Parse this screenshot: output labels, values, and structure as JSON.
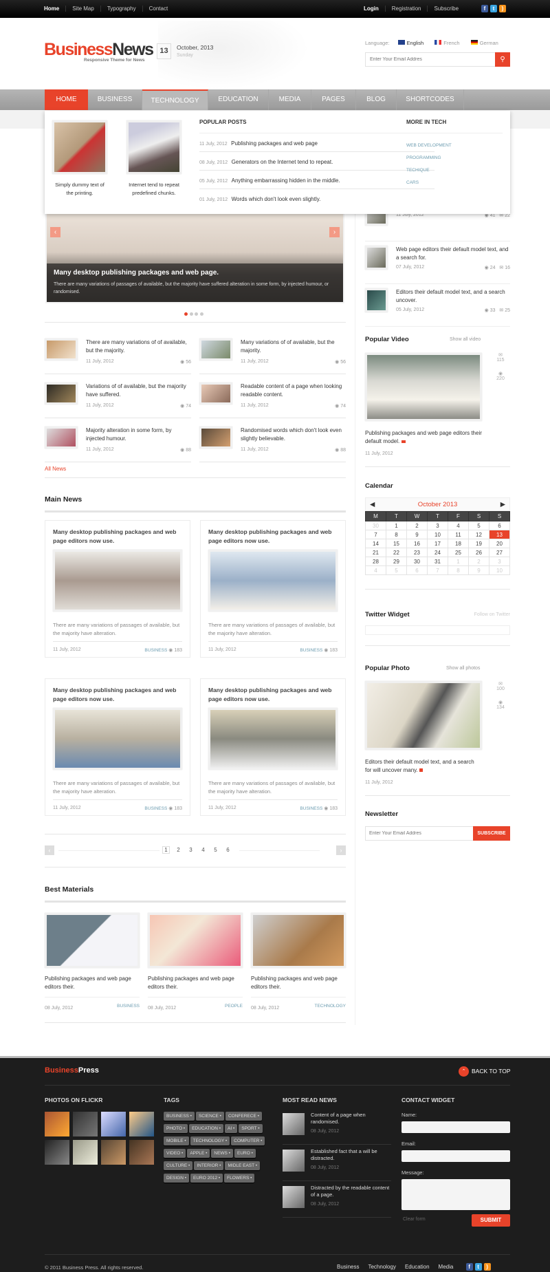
{
  "topbar": {
    "left": [
      "Home",
      "Site Map",
      "Typography",
      "Contact"
    ],
    "right": [
      "Login",
      "Registration",
      "Subscribe"
    ],
    "social": [
      "facebook-icon",
      "twitter-icon",
      "rss-icon"
    ]
  },
  "header": {
    "logo_a": "Business",
    "logo_b": "News",
    "tagline": "Responsive Theme for News",
    "day": "13",
    "month_year": "October, 2013",
    "weekday": "Sunday",
    "language_label": "Language:",
    "languages": [
      "English",
      "French",
      "German"
    ],
    "search_placeholder": "Enter Your Email Addres"
  },
  "nav": [
    "HOME",
    "BUSINESS",
    "TECHNOLOGY",
    "EDUCATION",
    "MEDIA",
    "PAGES",
    "BLOG",
    "SHORTCODES"
  ],
  "mega": {
    "features": [
      "Simply dummy text of the printing.",
      "Internet tend to repeat predefined chunks."
    ],
    "popular_title": "POPULAR POSTS",
    "popular": [
      {
        "date": "11 July, 2012",
        "title": "Publishing packages and web page"
      },
      {
        "date": "08 July, 2012",
        "title": "Generators on the Internet tend to repeat."
      },
      {
        "date": "05 July, 2012",
        "title": "Anything embarrassing hidden in the middle."
      },
      {
        "date": "01 July, 2012",
        "title": "Words which don't look even slightly."
      }
    ],
    "more_title": "MORE IN TECH",
    "more": [
      "WEB DEVELOPMENT",
      "PROGRAMMING",
      "TECHIQUE",
      "CARS"
    ]
  },
  "slider": {
    "title": "Many desktop publishing packages and web page.",
    "text": "There are many variations of passages of available, but the majority have suffered alteration in some form, by injected humour, or randomised.",
    "active_slide": 1,
    "slides": 4
  },
  "small_news": [
    {
      "title": "There are many variations of of available, but the majority.",
      "date": "11 July, 2012",
      "views": "56"
    },
    {
      "title": "Many variations of of available, but the majority.",
      "date": "11 July, 2012",
      "views": "56"
    },
    {
      "title": "Variations of of available, but the majority have suffered.",
      "date": "11 July, 2012",
      "views": "74"
    },
    {
      "title": "Readable content of a page when looking readable content.",
      "date": "11 July, 2012",
      "views": "74"
    },
    {
      "title": "Majority alteration in some form, by injected humour.",
      "date": "11 July, 2012",
      "views": "88"
    },
    {
      "title": "Randomised words which don't look even slightly believable.",
      "date": "11 July, 2012",
      "views": "88"
    }
  ],
  "all_news": "All News",
  "main_news": {
    "title": "Main News",
    "cards": [
      {
        "title": "Many desktop publishing packages and web page editors now use.",
        "text": "There are many variations of passages of available, but the majority have alteration.",
        "date": "11 July, 2012",
        "category": "BUSINESS",
        "views": "183"
      },
      {
        "title": "Many desktop publishing packages and web page editors now use.",
        "text": "There are many variations of passages of available, but the majority have alteration.",
        "date": "11 July, 2012",
        "category": "BUSINESS",
        "views": "183"
      },
      {
        "title": "Many desktop publishing packages and web page editors now use.",
        "text": "There are many variations of passages of available, but the majority have alteration.",
        "date": "11 July, 2012",
        "category": "BUSINESS",
        "views": "183"
      },
      {
        "title": "Many desktop publishing packages and web page editors now use.",
        "text": "There are many variations of passages of available, but the majority have alteration.",
        "date": "11 July, 2012",
        "category": "BUSINESS",
        "views": "183"
      }
    ],
    "pages": [
      "1",
      "2",
      "3",
      "4",
      "5",
      "6"
    ],
    "current_page": "1"
  },
  "best": {
    "title": "Best Materials",
    "items": [
      {
        "title": "Publishing packages and web page editors their.",
        "date": "08 July, 2012",
        "category": "BUSINESS"
      },
      {
        "title": "Publishing packages and web page editors their.",
        "date": "08 July, 2012",
        "category": "PEOPLE"
      },
      {
        "title": "Publishing packages and web page editors their.",
        "date": "08 July, 2012",
        "category": "TECHNOLOGY"
      }
    ]
  },
  "sidebar": {
    "list": [
      {
        "title": "",
        "date": "11 July, 2012",
        "views": "41",
        "comments": "22"
      },
      {
        "title": "Web page editors their default model text, and a search for.",
        "date": "07 July, 2012",
        "views": "24",
        "comments": "16"
      },
      {
        "title": "Editors their default model text, and a search uncover.",
        "date": "05 July, 2012",
        "views": "33",
        "comments": "25"
      }
    ],
    "video": {
      "title": "Popular Video",
      "link": "Show all video",
      "caption": "Publishing packages and web page editors their default model.",
      "date": "11 July, 2012",
      "comments": "115",
      "views": "220"
    },
    "calendar": {
      "title": "Calendar",
      "month": "October 2013",
      "days": [
        "M",
        "T",
        "W",
        "T",
        "F",
        "S",
        "S"
      ],
      "weeks": [
        [
          "30",
          "1",
          "2",
          "3",
          "4",
          "5",
          "6"
        ],
        [
          "7",
          "8",
          "9",
          "10",
          "11",
          "12",
          "13"
        ],
        [
          "14",
          "15",
          "16",
          "17",
          "18",
          "19",
          "20"
        ],
        [
          "21",
          "22",
          "23",
          "24",
          "25",
          "26",
          "27"
        ],
        [
          "28",
          "29",
          "30",
          "31",
          "1",
          "2",
          "3"
        ],
        [
          "4",
          "5",
          "6",
          "7",
          "8",
          "9",
          "10"
        ]
      ],
      "today": "13"
    },
    "twitter": {
      "title": "Twitter Widget",
      "link": "Follow on Twitter"
    },
    "photo": {
      "title": "Popular Photo",
      "link": "Show all photos",
      "caption": "Editors their default model text, and a search for will uncover many.",
      "date": "11 July, 2012",
      "comments": "100",
      "views": "134"
    },
    "newsletter": {
      "title": "Newsletter",
      "placeholder": "Enter Your Email Addres",
      "button": "SUBSCRIBE"
    }
  },
  "footer": {
    "logo_a": "Business",
    "logo_b": "Press",
    "back_to_top": "BACK TO TOP",
    "flickr_title": "PHOTOS ON FLICKR",
    "tags_title": "TAGS",
    "tags": [
      "BUSINESS",
      "SCIENCE",
      "CONFERECE",
      "PHOTO",
      "EDUCATION",
      "AI",
      "SPORT",
      "MOBILE",
      "TECHNOLOGY",
      "COMPUTER",
      "VIDEO",
      "APPLE",
      "NEWS",
      "EURO",
      "CULTURE",
      "INTERIOR",
      "MIDLE EAST",
      "DESIGN",
      "EURO 2012",
      "FLOWERS"
    ],
    "most_title": "MOST READ NEWS",
    "most": [
      {
        "title": "Content of a page when randomised.",
        "date": "08 July, 2012"
      },
      {
        "title": "Established fact that a will be distracted.",
        "date": "08 July, 2012"
      },
      {
        "title": "Distracted by the readable content of a page.",
        "date": "08 July, 2012"
      }
    ],
    "contact_title": "CONTACT WIDGET",
    "name_label": "Name:",
    "email_label": "Email:",
    "message_label": "Message:",
    "clear": "Clear form",
    "submit": "SUBMIT",
    "copyright": "© 2011 Business Press. All rights reserved.",
    "links": [
      "Business",
      "Technology",
      "Education",
      "Media"
    ]
  },
  "colors": {
    "accent": "#e8432a",
    "link_blue": "#6c9cb0",
    "footer_bg": "#1d1d1d"
  }
}
